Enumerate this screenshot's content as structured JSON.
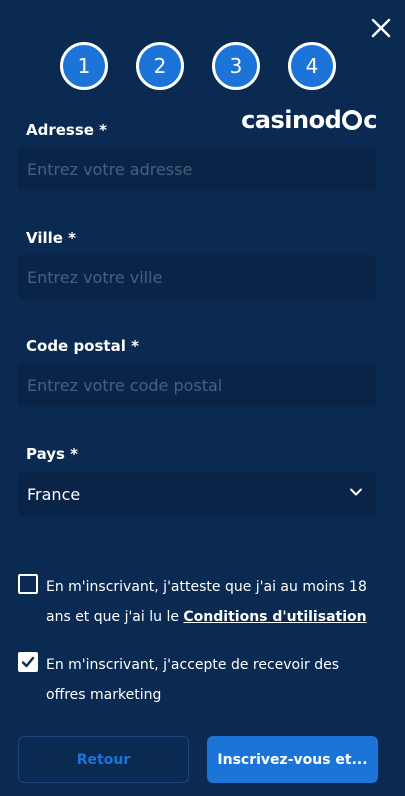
{
  "steps": [
    "1",
    "2",
    "3",
    "4"
  ],
  "logo": {
    "prefix": "casinod",
    "suffix": "c"
  },
  "form": {
    "address": {
      "label": "Adresse *",
      "placeholder": "Entrez votre adresse"
    },
    "city": {
      "label": "Ville *",
      "placeholder": "Entrez votre ville"
    },
    "postal": {
      "label": "Code postal *",
      "placeholder": "Entrez votre code postal"
    },
    "country": {
      "label": "Pays *",
      "value": "France"
    }
  },
  "checkboxes": {
    "terms": {
      "checked": false,
      "line1": "En m'inscrivant, j'atteste que j'ai au moins 18",
      "line2": "ans et que j'ai lu le ",
      "link": "Conditions d'utilisation"
    },
    "marketing": {
      "checked": true,
      "line1": "En m'inscrivant, j'accepte de recevoir des",
      "line2": "offres marketing"
    }
  },
  "buttons": {
    "back": "Retour",
    "submit": "Inscrivez-vous et..."
  },
  "colors": {
    "background": "#0b2a52",
    "accent": "#1c74d8",
    "input": "#0a2447"
  }
}
